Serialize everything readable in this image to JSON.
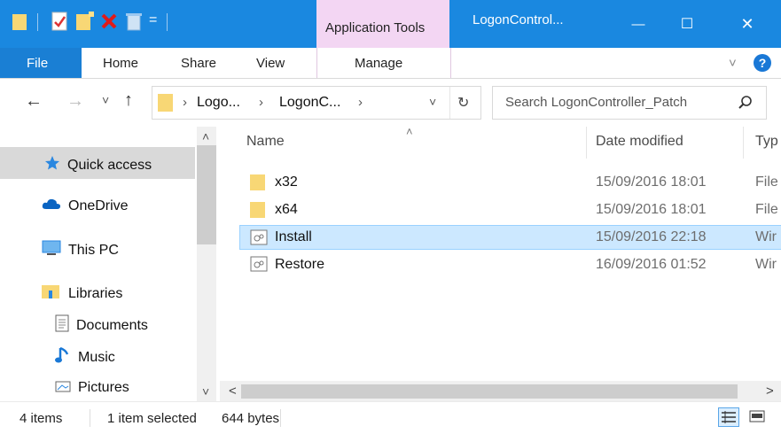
{
  "titlebar": {
    "context_tab": "Application Tools",
    "window_title": "LogonControl...",
    "qat_separator_glyph": "="
  },
  "window_controls": {
    "minimize": "—",
    "maximize": "☐",
    "close": "✕"
  },
  "ribbon": {
    "tabs": [
      "File",
      "Home",
      "Share",
      "View",
      "Manage"
    ],
    "collapse_glyph": "˅",
    "help_glyph": "?"
  },
  "address": {
    "back": "←",
    "forward": "→",
    "recent": "˅",
    "up": "↑",
    "crumbs": [
      "Logo...",
      "LogonC..."
    ],
    "sep": "›",
    "dropdown": "˅",
    "refresh": "↻"
  },
  "search": {
    "placeholder": "Search LogonController_Patch",
    "icon": "search-icon"
  },
  "nav": {
    "items": [
      {
        "label": "Quick access",
        "icon": "star-icon"
      },
      {
        "label": "OneDrive",
        "icon": "cloud-icon"
      },
      {
        "label": "This PC",
        "icon": "computer-icon"
      },
      {
        "label": "Libraries",
        "icon": "library-icon"
      },
      {
        "label": "Documents",
        "icon": "documents-icon"
      },
      {
        "label": "Music",
        "icon": "music-icon"
      },
      {
        "label": "Pictures",
        "icon": "pictures-icon"
      }
    ],
    "scroll_up": "˄",
    "scroll_down": "˅"
  },
  "columns": {
    "name": "Name",
    "date": "Date modified",
    "type": "Typ",
    "sort_glyph": "˄"
  },
  "files": [
    {
      "name": "x32",
      "date": "15/09/2016 18:01",
      "type": "File",
      "icon": "folder-icon",
      "selected": false
    },
    {
      "name": "x64",
      "date": "15/09/2016 18:01",
      "type": "File",
      "icon": "folder-icon",
      "selected": false
    },
    {
      "name": "Install",
      "date": "15/09/2016 22:18",
      "type": "Wir",
      "icon": "script-icon",
      "selected": true
    },
    {
      "name": "Restore",
      "date": "16/09/2016 01:52",
      "type": "Wir",
      "icon": "script-icon",
      "selected": false
    }
  ],
  "hscroll": {
    "left": "<",
    "right": ">"
  },
  "status": {
    "items_count": "4 items",
    "selection": "1 item selected",
    "size": "644 bytes"
  },
  "colors": {
    "titlebar": "#1a88e0",
    "context_tab": "#f3d6f3",
    "selection": "#cce8ff",
    "folder": "#f8d775"
  }
}
